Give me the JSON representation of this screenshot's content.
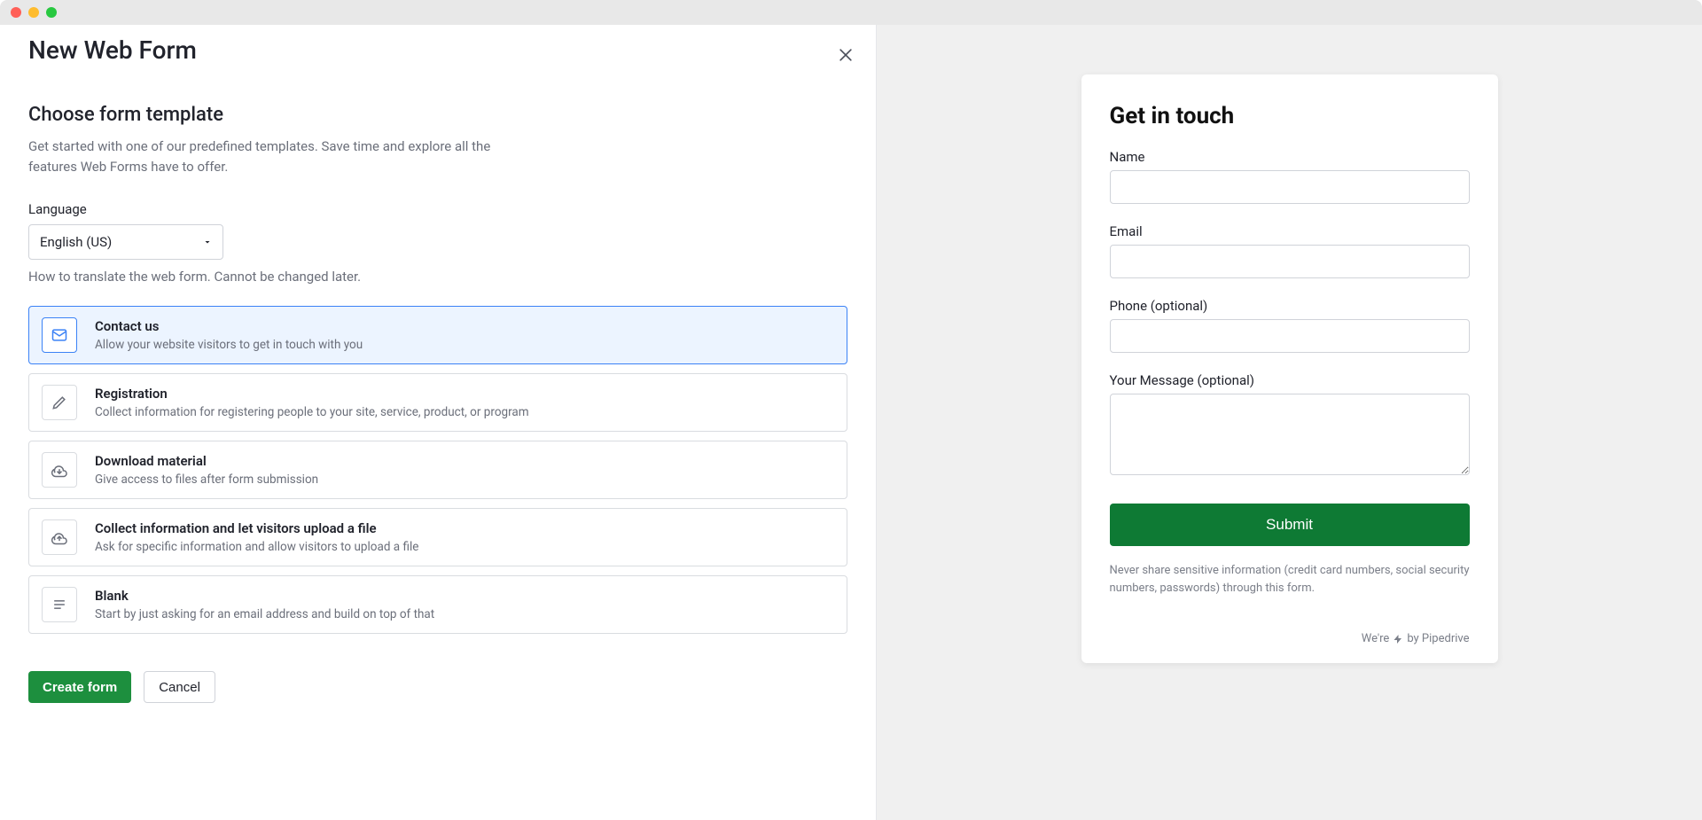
{
  "modal": {
    "title": "New Web Form",
    "section_title": "Choose form template",
    "section_desc": "Get started with one of our predefined templates. Save time and explore all the features Web Forms have to offer.",
    "language_label": "Language",
    "language_value": "English (US)",
    "language_help": "How to translate the web form. Cannot be changed later.",
    "create_label": "Create form",
    "cancel_label": "Cancel"
  },
  "templates": [
    {
      "icon": "mail",
      "title": "Contact us",
      "desc": "Allow your website visitors to get in touch with you",
      "selected": true
    },
    {
      "icon": "pencil",
      "title": "Registration",
      "desc": "Collect information for registering people to your site, service, product, or program",
      "selected": false
    },
    {
      "icon": "download",
      "title": "Download material",
      "desc": "Give access to files after form submission",
      "selected": false
    },
    {
      "icon": "upload",
      "title": "Collect information and let visitors upload a file",
      "desc": "Ask for specific information and allow visitors to upload a file",
      "selected": false
    },
    {
      "icon": "lines",
      "title": "Blank",
      "desc": "Start by just asking for an email address and build on top of that",
      "selected": false
    }
  ],
  "preview": {
    "title": "Get in touch",
    "fields": {
      "name": "Name",
      "email": "Email",
      "phone": "Phone (optional)",
      "message": "Your Message (optional)"
    },
    "submit": "Submit",
    "disclaimer": "Never share sensitive information (credit card numbers, social security numbers, passwords) through this form.",
    "powered_prefix": "We're",
    "powered_suffix": "by Pipedrive"
  }
}
